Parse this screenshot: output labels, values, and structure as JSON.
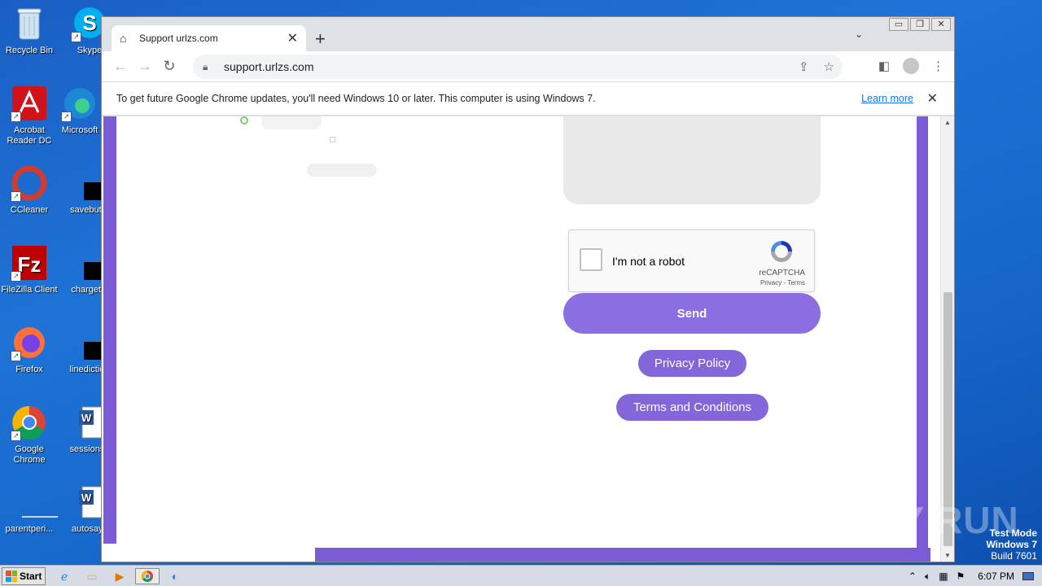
{
  "desktop": {
    "icons": [
      {
        "label": "Recycle Bin",
        "icon": "recycle-bin-icon"
      },
      {
        "label": "Skype",
        "icon": "skype-icon"
      },
      {
        "label": "Acrobat Reader DC",
        "icon": "acrobat-icon"
      },
      {
        "label": "Microsoft",
        "icon": "edge-icon"
      },
      {
        "label": "CCleaner",
        "icon": "ccleaner-icon"
      },
      {
        "label": "savebutto",
        "icon": "black-file-icon"
      },
      {
        "label": "FileZilla Client",
        "icon": "filezilla-icon"
      },
      {
        "label": "chargethi",
        "icon": "black-file-icon"
      },
      {
        "label": "Firefox",
        "icon": "firefox-icon"
      },
      {
        "label": "linediction",
        "icon": "black-file-icon"
      },
      {
        "label": "Google Chrome",
        "icon": "chrome-icon"
      },
      {
        "label": "sessionsu",
        "icon": "word-doc-icon"
      },
      {
        "label": "parentperi...",
        "icon": "blank-file-icon"
      },
      {
        "label": "autosays",
        "icon": "word-doc-icon"
      }
    ]
  },
  "browser": {
    "tab_title": "Support urlzs.com",
    "url": "support.urlzs.com",
    "infobar_text": "To get future Google Chrome updates, you'll need Windows 10 or later. This computer is using Windows 7.",
    "infobar_link": "Learn more"
  },
  "page": {
    "recaptcha_label": "I'm not a robot",
    "recaptcha_brand": "reCAPTCHA",
    "recaptcha_terms": "Privacy - Terms",
    "send_label": "Send",
    "privacy_label": "Privacy Policy",
    "terms_label": "Terms and Conditions",
    "accent_color": "#8b6ee0"
  },
  "overlay": {
    "watermark": "ANY RUN",
    "test_mode_line1": "Test Mode",
    "test_mode_line2": "Windows 7",
    "build": "Build 7601"
  },
  "taskbar": {
    "start_label": "Start",
    "clock": "6:07 PM"
  }
}
